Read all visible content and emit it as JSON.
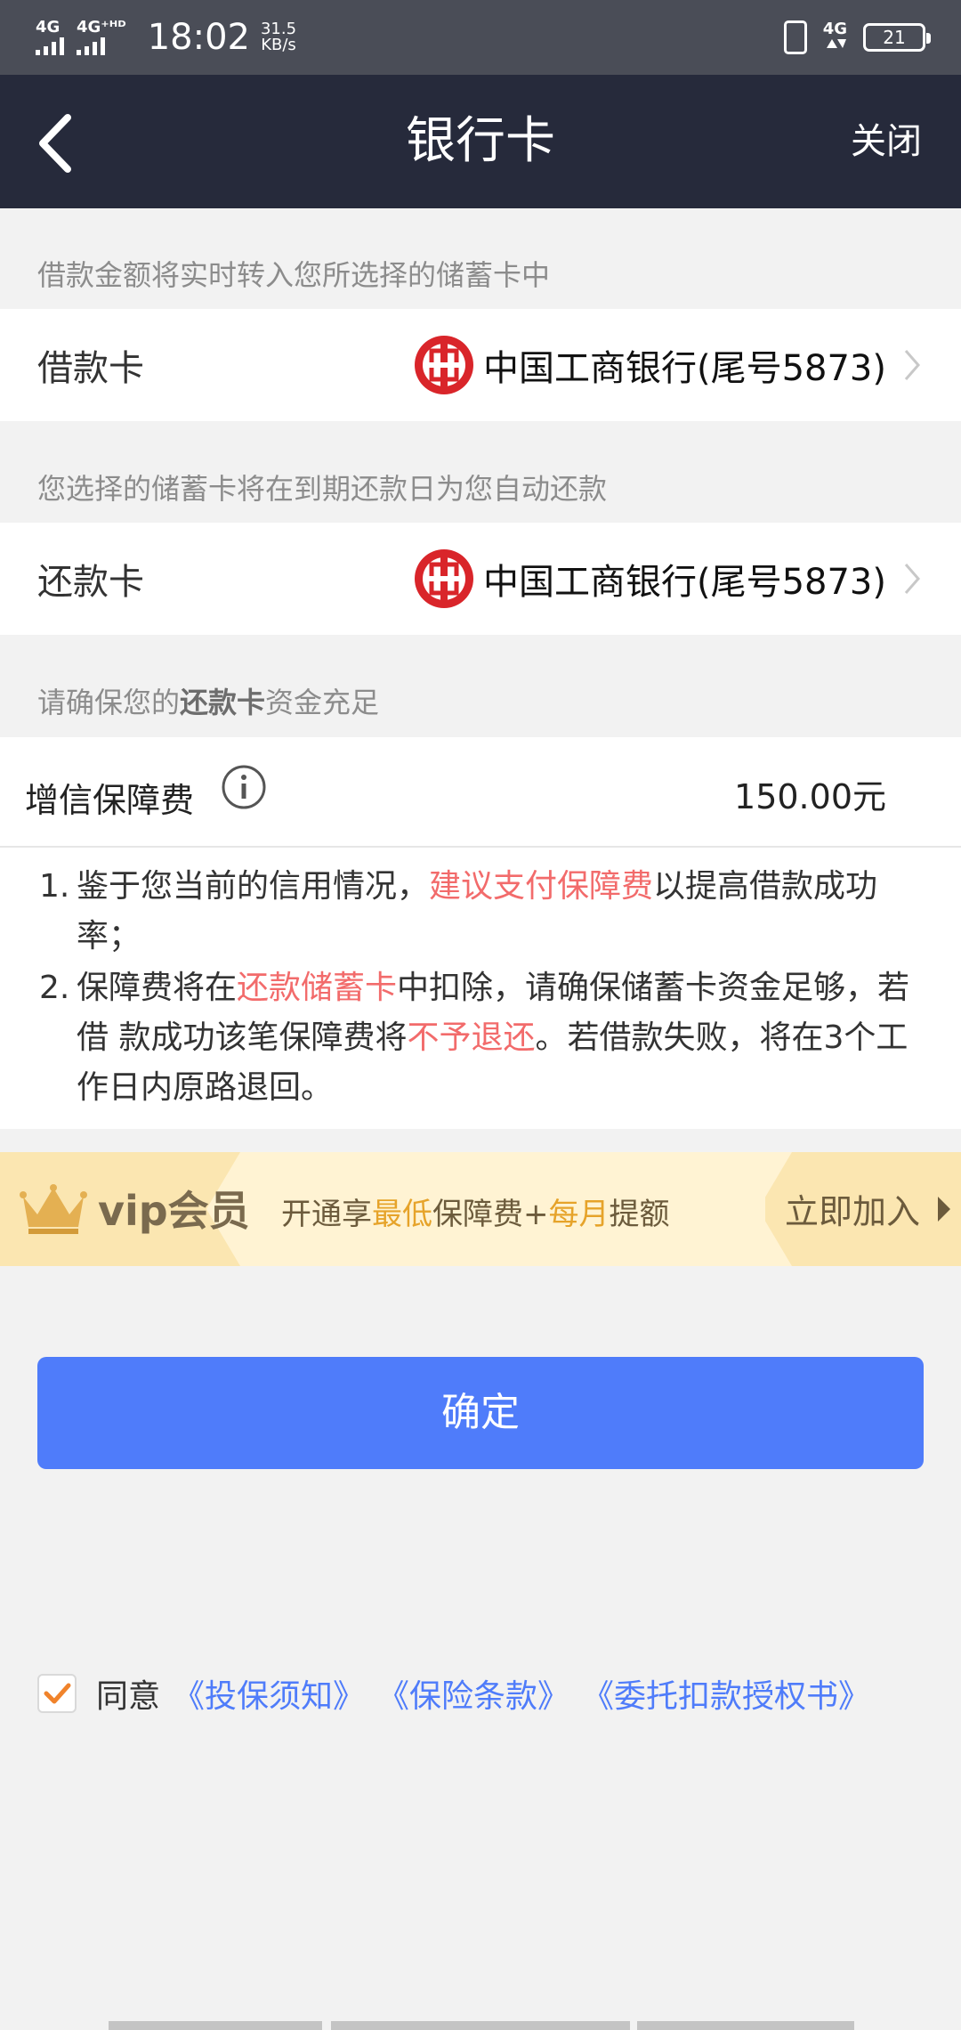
{
  "status_bar": {
    "signal1": "4G",
    "signal2": "4G⁺ᴴᴰ",
    "time": "18:02",
    "speed_value": "31.5",
    "speed_unit": "KB/s",
    "network": "4G",
    "battery": "21"
  },
  "nav": {
    "title": "银行卡",
    "close_label": "关闭"
  },
  "loan_card": {
    "hint": "借款金额将实时转入您所选择的储蓄卡中",
    "label": "借款卡",
    "bank": "中国工商银行(尾号5873)"
  },
  "repay_card": {
    "hint": "您选择的储蓄卡将在到期还款日为您自动还款",
    "label": "还款卡",
    "bank": "中国工商银行(尾号5873)"
  },
  "fund_hint": {
    "prefix": "请确保您的",
    "bold": "还款卡",
    "suffix": "资金充足"
  },
  "fee": {
    "label": "增信保障费",
    "amount": "150.00元"
  },
  "notes": {
    "n1_num": "1.",
    "n1_a": "鉴于您当前的信用情况，",
    "n1_red": "建议支付保障费",
    "n1_b": "以提高借款成功",
    "n1_c": "率；",
    "n2_num": "2.",
    "n2_a": "保障费将在",
    "n2_red1": "还款储蓄卡",
    "n2_b": "中扣除，请确保储蓄卡资金足够，若",
    "n2_c": "借 款成功该笔保障费将",
    "n2_red2": "不予退还",
    "n2_d": "。若借款失败，将在3个工",
    "n2_e": "作日内原路退回。"
  },
  "vip": {
    "title": "vip会员",
    "desc_a": "开通享",
    "desc_gold1": "最低",
    "desc_b": "保障费+",
    "desc_gold2": "每月",
    "desc_c": "提额",
    "join": "立即加入"
  },
  "confirm_label": "确定",
  "agreement": {
    "checked": true,
    "text": "同意",
    "link1": "《投保须知》",
    "link2": "《保险条款》",
    "link3": "《委托扣款授权书》"
  },
  "colors": {
    "nav_bg": "#262a3b",
    "accent_blue": "#4f7cfa",
    "highlight_red": "#f26b6b",
    "vip_gold": "#e6a32a",
    "check_orange": "#f0832b"
  }
}
